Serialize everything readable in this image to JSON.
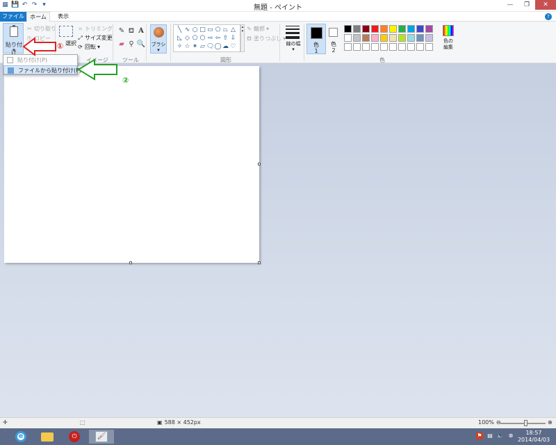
{
  "window": {
    "title": "無題 - ペイント",
    "controls": {
      "minimize": "—",
      "restore": "❐",
      "close": "✕"
    }
  },
  "tabs": [
    {
      "label": "ファイル"
    },
    {
      "label": "ホーム"
    },
    {
      "label": "表示"
    }
  ],
  "ribbon": {
    "clipboard": {
      "paste_label": "貼り付け",
      "cut_label": "切り取り",
      "copy_label": "コピー"
    },
    "image": {
      "select_label": "選択",
      "crop_label": "トリミング",
      "resize_label": "サイズ変更",
      "rotate_label": "回転",
      "group_label": "イメージ"
    },
    "tools": {
      "group_label": "ツール",
      "icons": [
        "pencil-icon",
        "fill-icon",
        "text-icon",
        "eraser-icon",
        "color-picker-icon",
        "magnifier-icon"
      ]
    },
    "brush": {
      "label": "ブラシ"
    },
    "shapes": {
      "group_label": "図形",
      "outline_label": "輪郭",
      "fill_label": "塗りつぶし",
      "glyphs": [
        "╲",
        "∿",
        "○",
        "□",
        "▭",
        "⬠",
        "⏢",
        "△",
        "◺",
        "◇",
        "⬠",
        "⬡",
        "⇨",
        "⇦",
        "⇧",
        "⇩",
        "✧",
        "☆",
        "✶",
        "▱",
        "🗨",
        "◯",
        "☁",
        "♡"
      ]
    },
    "line_width": {
      "label": "線の幅"
    },
    "colors": {
      "color1_label": "色\n1",
      "color2_label": "色\n2",
      "group_label": "色",
      "edit_label": "色の\n編集",
      "palette": [
        "#000000",
        "#7f7f7f",
        "#880015",
        "#ed1c24",
        "#ff7f27",
        "#fff200",
        "#22b14c",
        "#00a2e8",
        "#3f48cc",
        "#a349a4",
        "#ffffff",
        "#c3c3c3",
        "#b97a57",
        "#ffaec9",
        "#ffc90e",
        "#efe4b0",
        "#b5e61d",
        "#99d9ea",
        "#7092be",
        "#c8bfe7",
        "#ffffff",
        "#ffffff",
        "#ffffff",
        "#ffffff",
        "#ffffff",
        "#ffffff",
        "#ffffff",
        "#ffffff",
        "#ffffff",
        "#ffffff"
      ]
    }
  },
  "paste_menu": {
    "items": [
      {
        "label": "貼り付け(P)"
      },
      {
        "label": "ファイルから貼り付け(F)"
      }
    ]
  },
  "annotations": {
    "step1": "①",
    "step2": "②"
  },
  "status": {
    "canvas_size": "588 × 452px",
    "zoom": "100%"
  },
  "clock": {
    "time": "18:57",
    "date": "2014/04/03"
  }
}
